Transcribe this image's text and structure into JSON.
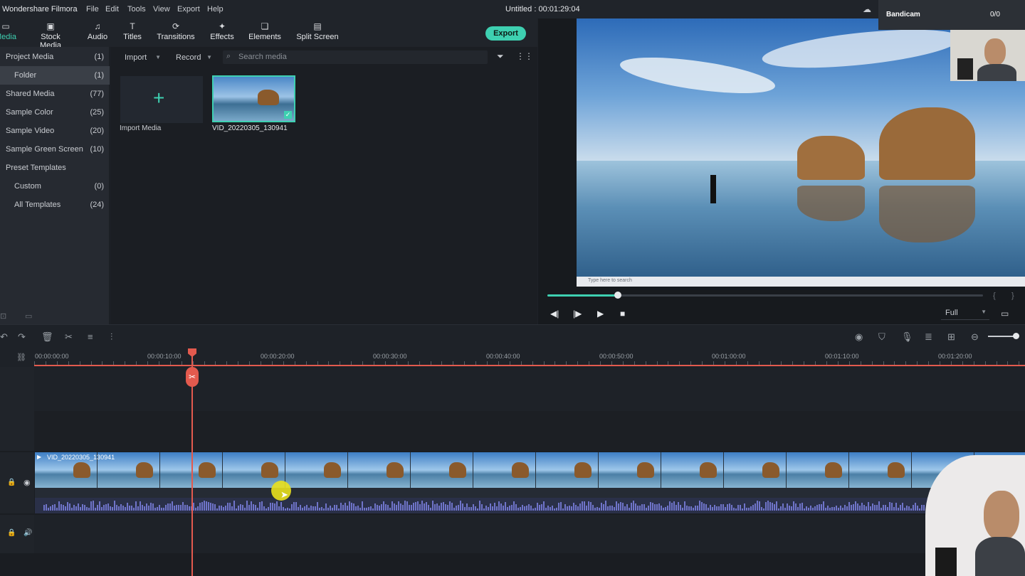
{
  "app": {
    "title": "Wondershare Filmora",
    "project_title": "Untitled : 00:01:29:04",
    "menu": [
      "File",
      "Edit",
      "Tools",
      "View",
      "Export",
      "Help"
    ]
  },
  "toolbar": {
    "tabs": [
      {
        "label": "Media",
        "icon": "folder-icon",
        "active": true
      },
      {
        "label": "Stock Media",
        "icon": "image-icon"
      },
      {
        "label": "Audio",
        "icon": "music-note-icon"
      },
      {
        "label": "Titles",
        "icon": "text-icon"
      },
      {
        "label": "Transitions",
        "icon": "transition-icon"
      },
      {
        "label": "Effects",
        "icon": "effects-icon"
      },
      {
        "label": "Elements",
        "icon": "elements-icon"
      },
      {
        "label": "Split Screen",
        "icon": "split-screen-icon"
      }
    ],
    "export_label": "Export"
  },
  "sidebar": {
    "items": [
      {
        "label": "Project Media",
        "count": "(1)"
      },
      {
        "label": "Folder",
        "count": "(1)",
        "selected": true,
        "indent": true
      },
      {
        "label": "Shared Media",
        "count": "(77)"
      },
      {
        "label": "Sample Color",
        "count": "(25)"
      },
      {
        "label": "Sample Video",
        "count": "(20)"
      },
      {
        "label": "Sample Green Screen",
        "count": "(10)"
      },
      {
        "label": "Preset Templates",
        "count": ""
      },
      {
        "label": "Custom",
        "count": "(0)",
        "indent": true
      },
      {
        "label": "All Templates",
        "count": "(24)",
        "indent": true
      }
    ]
  },
  "media": {
    "import_label": "Import",
    "record_label": "Record",
    "search_placeholder": "Search media",
    "import_tile_label": "Import Media",
    "clip_name": "VID_20220305_130941"
  },
  "preview": {
    "progress_fraction": 0.162,
    "zoom_label": "Full",
    "taskbar_search": "Type here to search"
  },
  "bandicam": {
    "title": "Bandicam",
    "count": "0/0"
  },
  "timeline": {
    "tick_labels": [
      "00:00:00:00",
      "00:00:10:00",
      "00:00:20:00",
      "00:00:30:00",
      "00:00:40:00",
      "00:00:50:00",
      "00:01:00:00",
      "00:01:10:00",
      "00:01:20:00"
    ],
    "clip_label": "VID_20220305_130941",
    "playhead_time_fraction": 0.158
  },
  "colors": {
    "accent": "#3ed0b1",
    "playhead": "#e35a4e"
  }
}
